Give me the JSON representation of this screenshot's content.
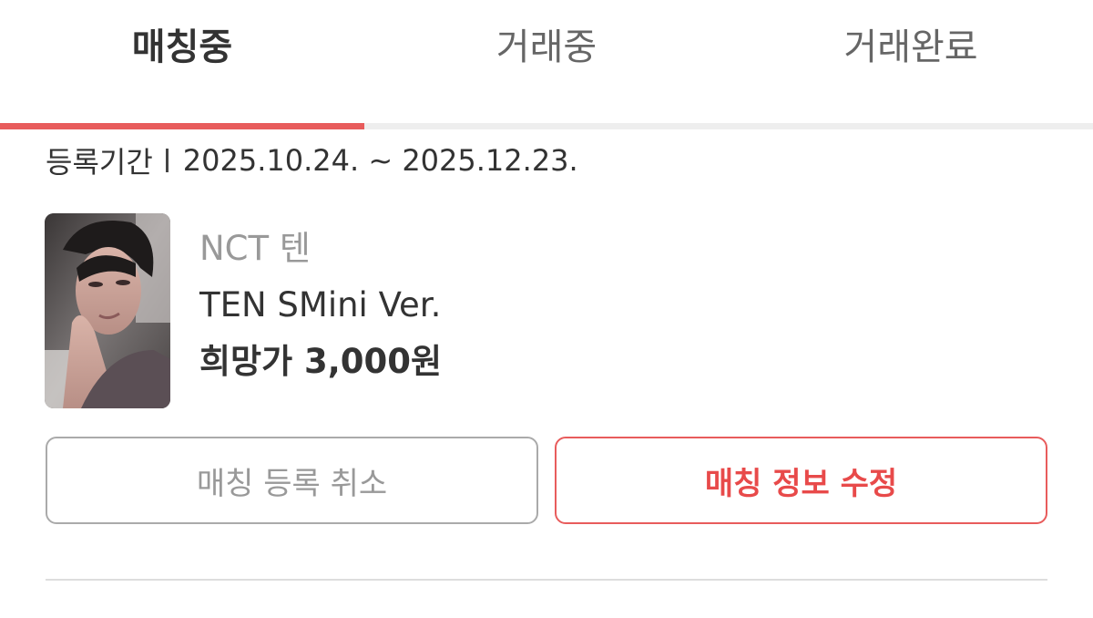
{
  "tabs": [
    {
      "label": "매칭중",
      "active": true
    },
    {
      "label": "거래중",
      "active": false
    },
    {
      "label": "거래완료",
      "active": false
    }
  ],
  "accent_color": "#e85c5c",
  "period": {
    "label": "등록기간",
    "range": "2025.10.24. ~ 2025.12.23."
  },
  "item": {
    "thumbnail": "photocard-image",
    "group": "NCT 텐",
    "name": "TEN SMini Ver.",
    "price": "희망가 3,000원"
  },
  "actions": {
    "cancel_label": "매칭 등록 취소",
    "edit_label": "매칭 정보 수정"
  }
}
